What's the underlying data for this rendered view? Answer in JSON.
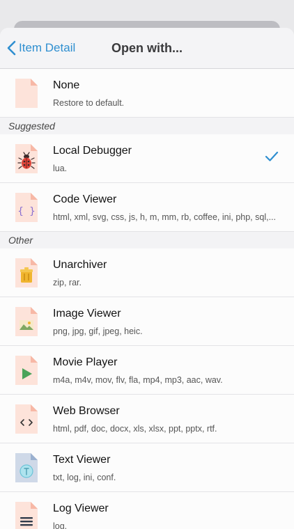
{
  "nav": {
    "back_label": "Item Detail",
    "title": "Open with..."
  },
  "top_item": {
    "title": "None",
    "subtitle": "Restore to default.",
    "icon": "blank-file-icon"
  },
  "sections": [
    {
      "header": "Suggested",
      "items": [
        {
          "title": "Local Debugger",
          "subtitle": "lua.",
          "icon": "bug-icon",
          "selected": true
        },
        {
          "title": "Code Viewer",
          "subtitle": "html, xml, svg, css, js, h, m, mm, rb, coffee, ini, php, sql,...",
          "icon": "curly-braces-icon",
          "selected": false
        }
      ]
    },
    {
      "header": "Other",
      "items": [
        {
          "title": "Unarchiver",
          "subtitle": "zip, rar.",
          "icon": "archive-icon"
        },
        {
          "title": "Image Viewer",
          "subtitle": "png, jpg, gif, jpeg, heic.",
          "icon": "image-icon"
        },
        {
          "title": "Movie Player",
          "subtitle": "m4a, m4v, mov, flv, fla, mp4, mp3, aac, wav.",
          "icon": "play-icon"
        },
        {
          "title": "Web Browser",
          "subtitle": "html, pdf, doc, docx, xls, xlsx, ppt, pptx, rtf.",
          "icon": "code-brackets-icon"
        },
        {
          "title": "Text Viewer",
          "subtitle": "txt, log, ini, conf.",
          "icon": "text-icon"
        },
        {
          "title": "Log Viewer",
          "subtitle": "log.",
          "icon": "lines-icon"
        }
      ]
    }
  ],
  "colors": {
    "accent": "#2f8fd0",
    "file_pink": "#fde3da",
    "file_fold": "#f7b8a6",
    "file_blue": "#cfd9e8",
    "file_blue_fold": "#9ab0cf"
  }
}
